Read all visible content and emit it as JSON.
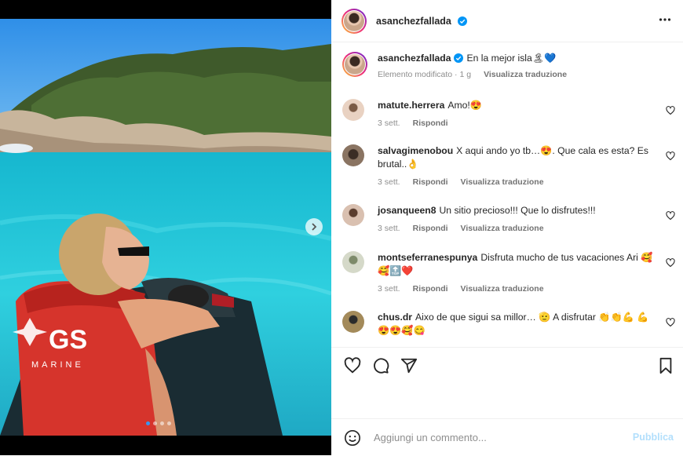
{
  "post": {
    "username": "asanchezfallada",
    "caption": "En la mejor isla🏝💙",
    "caption_meta": "Elemento modificato · 1 g",
    "translate_label": "Visualizza traduzione",
    "carousel_count": 4,
    "carousel_index": 1,
    "photo_badge": "GS",
    "photo_badge_sub": "MARINE"
  },
  "comments": [
    {
      "user": "matute.herrera",
      "text": "Amo!😍",
      "time": "3 sett.",
      "reply": "Rispondi",
      "translate": ""
    },
    {
      "user": "salvagimenobou",
      "text": "X aqui ando yo tb…😍. Que cala es esta? Es brutal..👌",
      "time": "3 sett.",
      "reply": "Rispondi",
      "translate": "Visualizza traduzione"
    },
    {
      "user": "josanqueen8",
      "text": "Un sitio precioso!!! Que lo disfrutes!!!",
      "time": "3 sett.",
      "reply": "Rispondi",
      "translate": "Visualizza traduzione"
    },
    {
      "user": "montseferranespunya",
      "text": "Disfruta mucho de tus vacaciones Ari 🥰🥰🔝❤️",
      "time": "3 sett.",
      "reply": "Rispondi",
      "translate": "Visualizza traduzione"
    },
    {
      "user": "chus.dr",
      "text": "Aixo de que sigui sa millor… 🫡 A disfrutar 👏👏💪 💪😍😍🥰😋",
      "time": "",
      "reply": "",
      "translate": ""
    }
  ],
  "add_comment": {
    "placeholder": "Aggiungi un commento...",
    "publish": "Pubblica"
  },
  "icons": [
    "heart-icon",
    "comment-icon",
    "share-icon",
    "bookmark-icon",
    "emoji-icon",
    "more-icon",
    "verified-icon",
    "chevron-right-icon"
  ],
  "colors": {
    "accent": "#0095f6",
    "verified": "#0095f6",
    "publish_disabled": "#b2dffc"
  }
}
